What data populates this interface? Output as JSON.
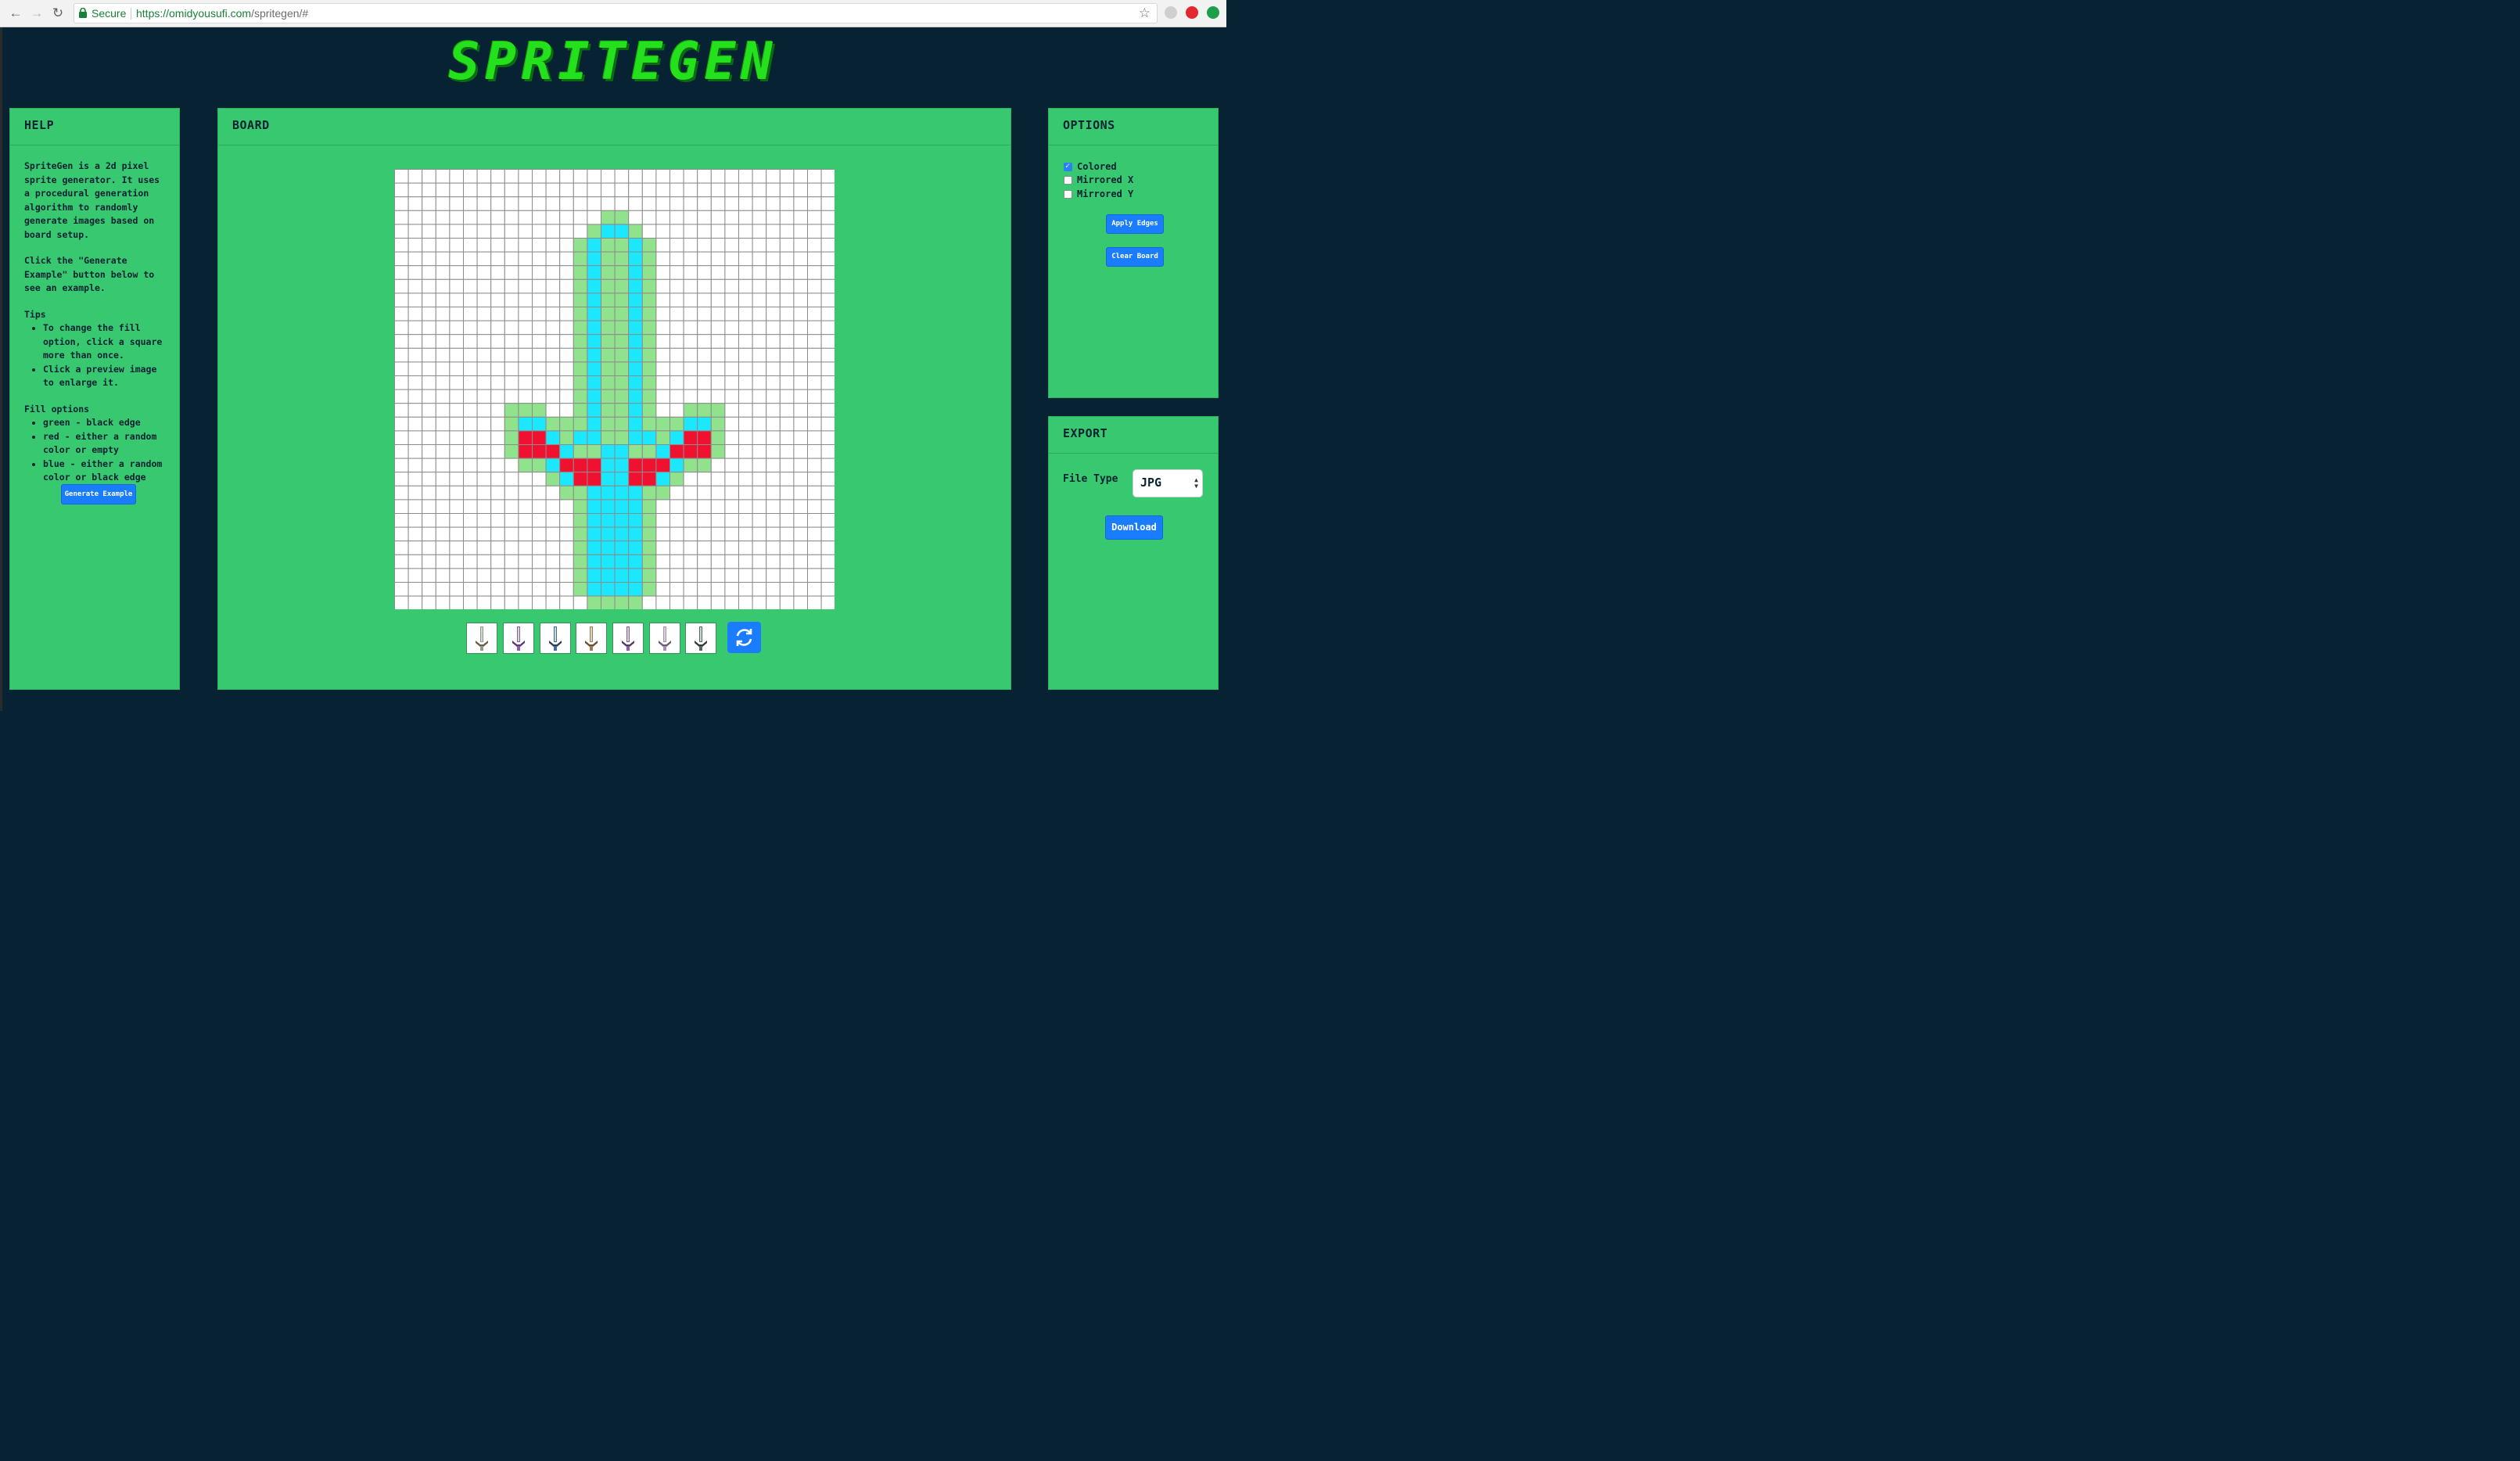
{
  "browser": {
    "secure_label": "Secure",
    "url_base": "https://omidyousufi.com",
    "url_path": "/spritegen/#"
  },
  "app": {
    "logo": "SPRITEGEN"
  },
  "help": {
    "title": "HELP",
    "intro": "SpriteGen is a 2d pixel sprite generator. It uses a procedural generation algorithm to randomly generate images based on board setup.",
    "click_note": "Click the \"Generate Example\" button below to see an example.",
    "tips_title": "Tips",
    "tips": [
      "To change the fill option, click a square more than once.",
      "Click a preview image to enlarge it."
    ],
    "fill_title": "Fill options",
    "fill_options": [
      "green - black edge",
      "red - either a random color or empty",
      "blue - either a random color or black edge"
    ],
    "generate_button": "Generate Example"
  },
  "board": {
    "title": "BOARD",
    "grid_size": 32,
    "colors": {
      "empty": "#ffffff",
      "green": "#90e28c",
      "blue": "#1be8ff",
      "red": "#f01030"
    }
  },
  "options": {
    "title": "OPTIONS",
    "checkboxes": [
      {
        "label": "Colored",
        "checked": true
      },
      {
        "label": "Mirrored X",
        "checked": false
      },
      {
        "label": "Mirrored Y",
        "checked": false
      }
    ],
    "apply_edges": "Apply Edges",
    "clear_board": "Clear Board"
  },
  "export": {
    "title": "EXPORT",
    "file_type_label": "File Type",
    "file_type_value": "JPG",
    "download": "Download"
  },
  "previews": [
    {
      "blade": "#8f9a88",
      "guard": "#6b5a3e"
    },
    {
      "blade": "#8a5fb0",
      "guard": "#5a3a7a"
    },
    {
      "blade": "#3a6f99",
      "guard": "#2b3f55"
    },
    {
      "blade": "#9a7a55",
      "guard": "#6a4a30"
    },
    {
      "blade": "#8a5ca8",
      "guard": "#4b3a66"
    },
    {
      "blade": "#a98fae",
      "guard": "#6b5a75"
    },
    {
      "blade": "#4f6a5e",
      "guard": "#2e3b35"
    }
  ]
}
